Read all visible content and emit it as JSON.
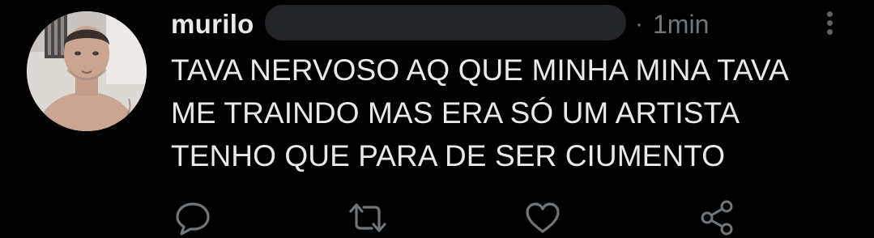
{
  "tweet": {
    "author_name": "murilo",
    "separator": "·",
    "time": "1min",
    "text": "TAVA NERVOSO AQ QUE MINHA MINA TAVA\nME TRAINDO MAS ERA SÓ UM ARTISTA\nTENHO QUE PARA DE SER CIUMENTO"
  },
  "actions": {
    "reply_icon": "speech-bubble",
    "retweet_icon": "retweet-arrows",
    "like_icon": "heart-outline",
    "share_icon": "share-nodes"
  },
  "colors": {
    "background": "#000000",
    "text_primary": "#e7e9ea",
    "text_secondary": "#71767b",
    "redaction": "#232427"
  }
}
